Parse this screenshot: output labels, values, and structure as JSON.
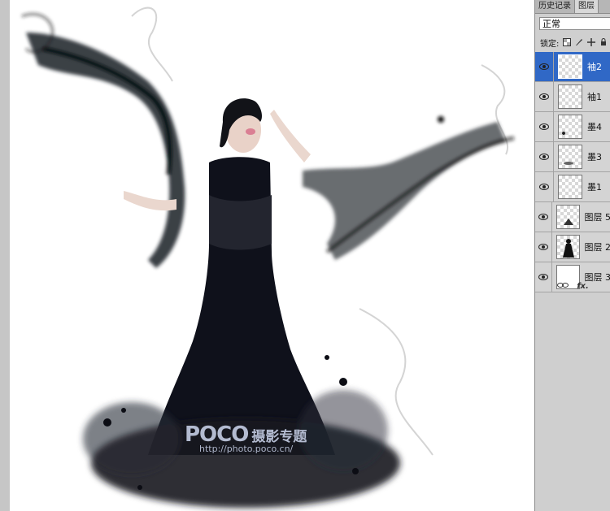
{
  "panel": {
    "tabs": [
      "历史记录",
      "图层"
    ],
    "blend_mode": "正常",
    "lock_label": "锁定:",
    "lock_icons": [
      "lock-transparency-icon",
      "lock-paint-icon",
      "lock-move-icon",
      "lock-all-icon"
    ],
    "layers": [
      {
        "name": "袖2",
        "selected": true,
        "thumb": "transparent"
      },
      {
        "name": "袖1",
        "selected": false,
        "thumb": "transparent"
      },
      {
        "name": "墨4",
        "selected": false,
        "thumb": "transparent"
      },
      {
        "name": "墨3",
        "selected": false,
        "thumb": "transparent"
      },
      {
        "name": "墨1",
        "selected": false,
        "thumb": "transparent"
      },
      {
        "name": "图层 5",
        "selected": false,
        "thumb": "transparent"
      },
      {
        "name": "图层 2",
        "selected": false,
        "thumb": "figure"
      },
      {
        "name": "图层 3",
        "selected": false,
        "thumb": "white"
      }
    ],
    "footer": {
      "link_icon": "link-icon",
      "fx_label": "fx."
    }
  },
  "canvas": {
    "watermark": {
      "brand": "POCO",
      "brand_cn": "摄影专题",
      "url": "http://photo.poco.cn/"
    }
  },
  "colors": {
    "selected": "#3068c6",
    "panel": "#cfcfcf",
    "ink": "#0d0f1a"
  }
}
